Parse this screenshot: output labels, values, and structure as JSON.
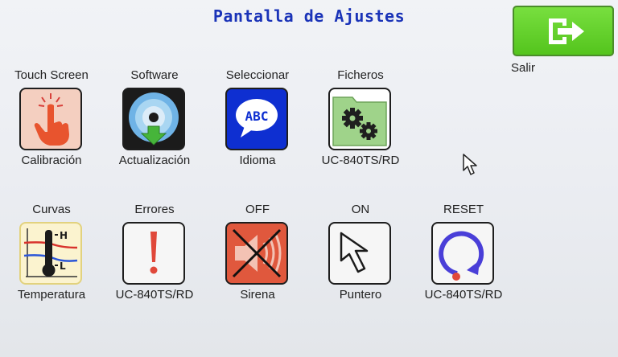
{
  "header": {
    "title": "Pantalla de Ajustes"
  },
  "exit": {
    "label": "Salir",
    "icon": "exit-arrow-icon"
  },
  "tiles": [
    {
      "top": "Touch Screen",
      "bottom": "Calibración",
      "icon": "touch-hand-icon"
    },
    {
      "top": "Software",
      "bottom": "Actualización",
      "icon": "cd-update-icon"
    },
    {
      "top": "Seleccionar",
      "bottom": "Idioma",
      "icon": "language-bubble-icon",
      "icon_text": "ABC"
    },
    {
      "top": "Ficheros",
      "bottom": "UC-840TS/RD",
      "icon": "folder-gears-icon"
    },
    {
      "top": "Curvas",
      "bottom": "Temperatura",
      "icon": "thermometer-chart-icon",
      "icon_text_high": "H",
      "icon_text_low": "L"
    },
    {
      "top": "Errores",
      "bottom": "UC-840TS/RD",
      "icon": "exclamation-icon"
    },
    {
      "top": "OFF",
      "bottom": "Sirena",
      "icon": "siren-muted-icon"
    },
    {
      "top": "ON",
      "bottom": "Puntero",
      "icon": "pointer-arrow-icon"
    },
    {
      "top": "RESET",
      "bottom": "UC-840TS/RD",
      "icon": "reset-circle-icon"
    }
  ],
  "colors": {
    "title": "#1a33b8",
    "exit_button": "#5fcf28",
    "background": "#eceef2"
  }
}
